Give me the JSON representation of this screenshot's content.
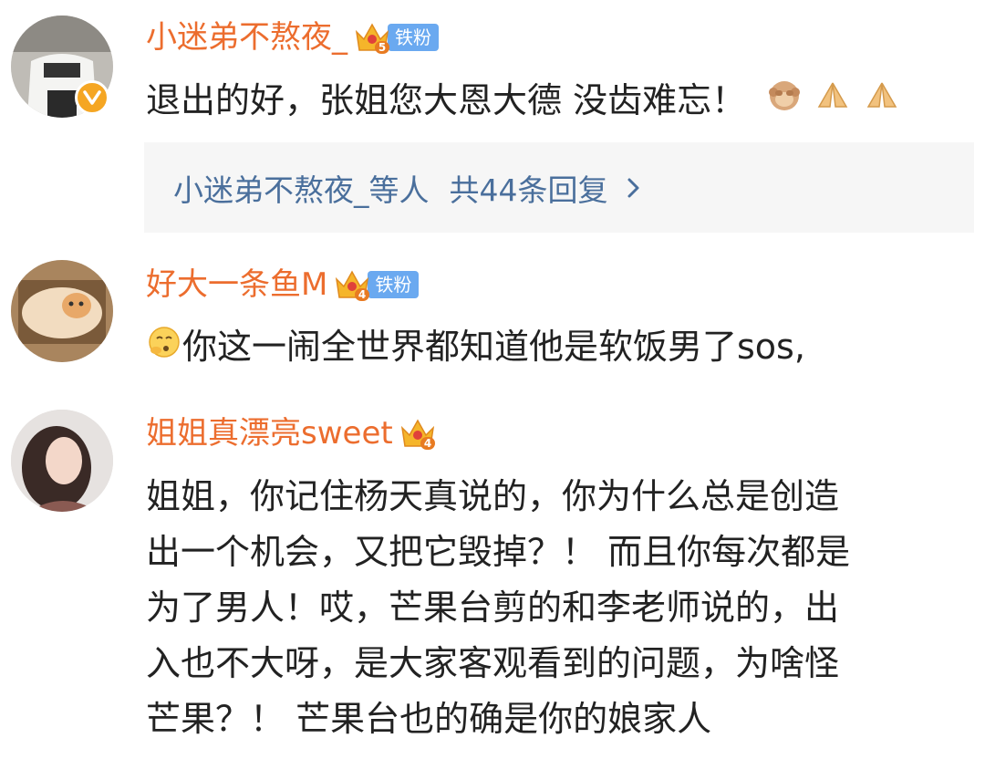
{
  "comments": [
    {
      "username": "小迷弟不熬夜_",
      "crown_level": "5",
      "fan_tag": "铁粉",
      "text": "退出的好，张姐您大恩大德 没齿难忘！",
      "reply_summary": {
        "names": "小迷弟不熬夜_等人",
        "count_text": "共44条回复"
      }
    },
    {
      "username": "好大一条鱼M",
      "crown_level": "4",
      "fan_tag": "铁粉",
      "text": "你这一闹全世界都知道他是软饭男了sos,"
    },
    {
      "username": "姐姐真漂亮sweet",
      "crown_level": "4",
      "text_lines": [
        "姐姐，你记住杨天真说的，你为什么总是创造",
        "出一个机会，又把它毁掉？！ 而且你每次都是",
        "为了男人！哎，芒果台剪的和李老师说的，出",
        "入也不大呀，是大家客观看到的问题，为啥怪",
        "芒果？！ 芒果台也的确是你的娘家人"
      ]
    }
  ],
  "colors": {
    "username": "#ec6d2e",
    "fan_tag_bg": "#6aa9f0",
    "reply_text": "#4a6f9c",
    "reply_bg": "#f6f6f6",
    "body_text": "#222222"
  },
  "icons": [
    "verified-badge-icon",
    "crown-level-icon",
    "monkey-emoji-icon",
    "pray-emoji-icon",
    "chevron-right-icon",
    "thinking-emoji-icon"
  ]
}
